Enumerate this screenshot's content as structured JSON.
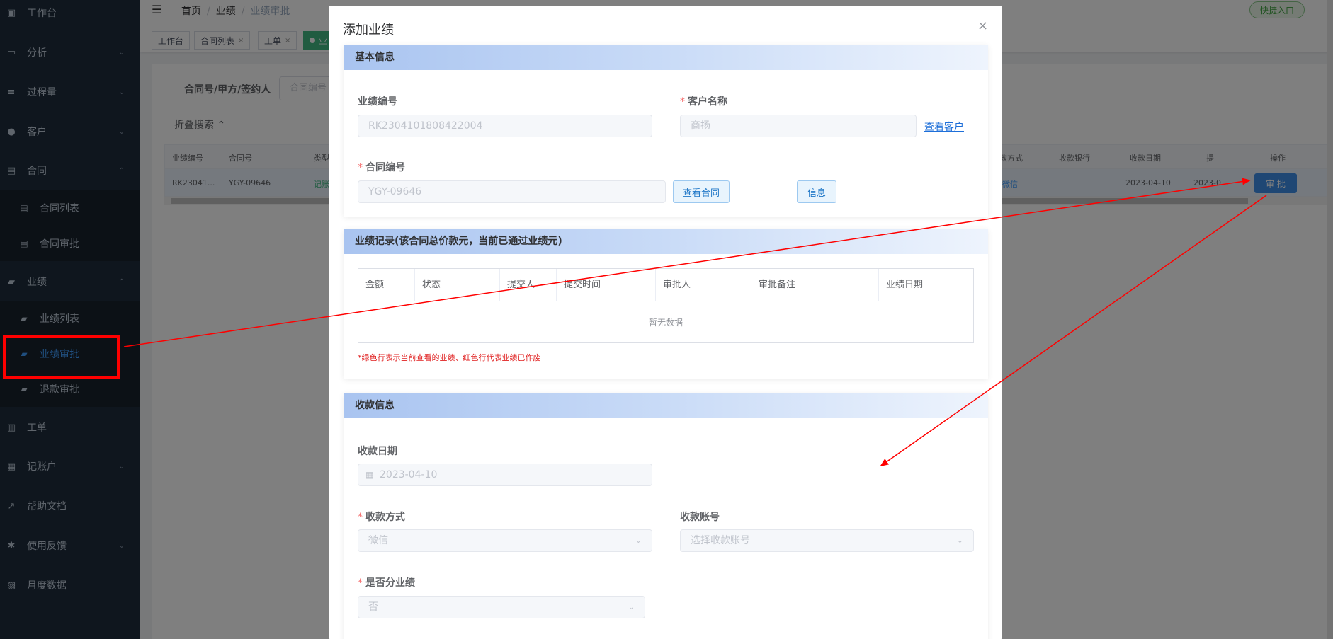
{
  "sidebar": {
    "items": [
      {
        "label": "工作台",
        "icon": "dashboard-icon",
        "glyph": "▣"
      },
      {
        "label": "分析",
        "icon": "monitor-icon",
        "glyph": "▭"
      },
      {
        "label": "过程量",
        "icon": "chart-icon",
        "glyph": "≡"
      },
      {
        "label": "客户",
        "icon": "user-icon",
        "glyph": "●"
      },
      {
        "label": "合同",
        "icon": "document-icon",
        "glyph": "▤"
      },
      {
        "label": "业绩",
        "icon": "briefcase-icon",
        "glyph": "▰"
      },
      {
        "label": "工单",
        "icon": "clipboard-icon",
        "glyph": "▥"
      },
      {
        "label": "记账户",
        "icon": "book-icon",
        "glyph": "▦"
      },
      {
        "label": "帮助文档",
        "icon": "external-link-icon",
        "glyph": "↗"
      },
      {
        "label": "使用反馈",
        "icon": "bug-icon",
        "glyph": "✱"
      },
      {
        "label": "月度数据",
        "icon": "bar-chart-icon",
        "glyph": "▨"
      }
    ],
    "contract_sub": [
      "合同列表",
      "合同审批"
    ],
    "perf_sub": [
      "业绩列表",
      "业绩审批",
      "退款审批"
    ]
  },
  "header": {
    "breadcrumb": [
      "首页",
      "业绩",
      "业绩审批"
    ],
    "quick_entry": "快捷入口"
  },
  "tags": [
    "工作台",
    "合同列表",
    "工单",
    "业"
  ],
  "filter": {
    "label": "合同号/甲方/签约人",
    "placeholder": "合同编号",
    "collapse": "折叠搜索"
  },
  "table": {
    "headers": [
      "业绩编号",
      "合同号",
      "类型",
      "款方式",
      "收款银行",
      "收款日期",
      "提",
      "操作"
    ],
    "row": {
      "id": "RK23041...",
      "contract": "YGY-09646",
      "type": "记账",
      "method": "微信",
      "date": "2023-04-10",
      "submit_date": "2023-0...",
      "action": "审 批"
    }
  },
  "modal": {
    "title": "添加业绩",
    "close": "×",
    "basic": {
      "title": "基本信息",
      "perf_no_label": "业绩编号",
      "perf_no_value": "RK2304101808422004",
      "customer_label": "客户名称",
      "customer_value": "商扬",
      "view_customer": "查看客户",
      "contract_label": "合同编号",
      "contract_value": "YGY-09646",
      "view_contract": "查看合同",
      "info": "信息"
    },
    "records": {
      "title": "业绩记录(该合同总价款元，当前已通过业绩元)",
      "headers": [
        "金额",
        "状态",
        "提交人",
        "提交时间",
        "审批人",
        "审批备注",
        "业绩日期"
      ],
      "empty": "暂无数据",
      "note": "*绿色行表示当前查看的业绩、红色行代表业绩已作废"
    },
    "payment": {
      "title": "收款信息",
      "date_label": "收款日期",
      "date_value": "2023-04-10",
      "method_label": "收款方式",
      "method_value": "微信",
      "account_label": "收款账号",
      "account_placeholder": "选择收款账号",
      "split_label": "是否分业绩",
      "split_value": "否"
    }
  },
  "colors": {
    "sidebar_bg": "#1f2d3d",
    "active": "#409eff",
    "annotation": "#ff0000"
  }
}
